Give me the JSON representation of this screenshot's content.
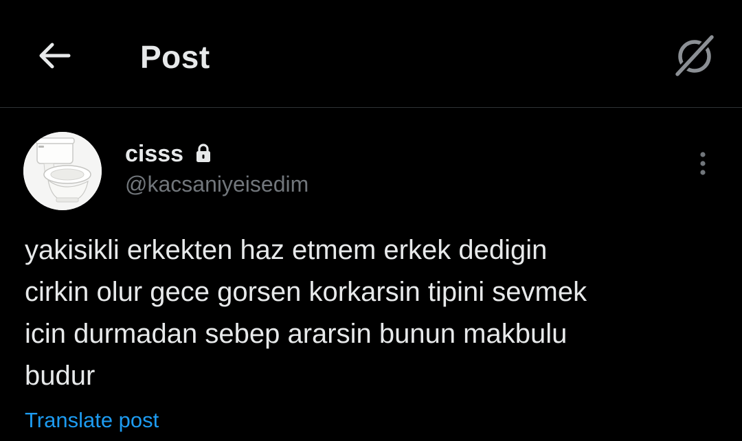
{
  "header": {
    "title": "Post",
    "back_icon": "arrow-left-icon",
    "grok_icon": "grok-icon"
  },
  "post": {
    "author": {
      "display_name": "cisss",
      "handle": "@kacsaniyeisedim",
      "protected_icon": "lock-icon",
      "avatar": "toilet-avatar"
    },
    "more_icon": "more-vertical-icon",
    "text": "yakisikli erkekten haz etmem erkek dedigin\ncirkin olur gece gorsen korkarsin tipini sevmek\nicin durmadan sebep ararsin bunun makbulu\nbudur",
    "translate_label": "Translate post"
  },
  "colors": {
    "background": "#000000",
    "text_primary": "#e7e9ea",
    "text_secondary": "#71767b",
    "link": "#1d9bf0",
    "divider": "#2f3336"
  }
}
